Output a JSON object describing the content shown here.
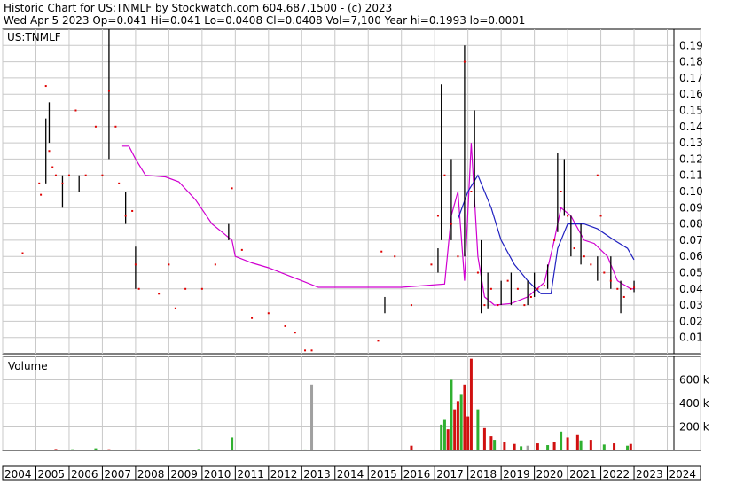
{
  "header": {
    "line1": "Historic Chart for US:TNMLF by Stockwatch.com 604.687.1500 - (c) 2023",
    "line2": "Wed Apr  5 2023  Op=0.041  Hi=0.041  Lo=0.0408  Cl=0.0408  Vol=7,100  Year hi=0.1993  lo=0.0001"
  },
  "price_panel_label": "US:TNMLF",
  "volume_panel_label": "Volume",
  "colors": {
    "grid": "#c8c8c8",
    "price_bar": "#000000",
    "close_dot": "#e00000",
    "ma_short": "#d000d0",
    "ma_long": "#2020c0",
    "vol_up": "#30b030",
    "vol_down": "#d01010",
    "vol_flat": "#a0a0a0"
  },
  "chart_data": [
    {
      "type": "line",
      "title": "US:TNMLF",
      "ylim": [
        0,
        0.2
      ],
      "yticks": [
        "0.01",
        "0.02",
        "0.03",
        "0.04",
        "0.05",
        "0.06",
        "0.07",
        "0.08",
        "0.09",
        "0.10",
        "0.11",
        "0.12",
        "0.13",
        "0.14",
        "0.15",
        "0.16",
        "0.17",
        "0.18",
        "0.19"
      ],
      "x_years": [
        "2004",
        "2005",
        "2006",
        "2007",
        "2008",
        "2009",
        "2010",
        "2011",
        "2012",
        "2013",
        "2014",
        "2015",
        "2016",
        "2017",
        "2018",
        "2019",
        "2020",
        "2021",
        "2022",
        "2023",
        "2024"
      ],
      "bars": [
        [
          2005.3,
          0.105,
          0.145,
          0.12
        ],
        [
          2005.4,
          0.13,
          0.155,
          0.14
        ],
        [
          2005.8,
          0.09,
          0.11,
          0.1
        ],
        [
          2006.3,
          0.1,
          0.11,
          0.105
        ],
        [
          2007.2,
          0.12,
          0.2,
          0.15
        ],
        [
          2007.7,
          0.08,
          0.1,
          0.09
        ],
        [
          2008.0,
          0.04,
          0.066,
          0.05
        ],
        [
          2010.8,
          0.07,
          0.08,
          0.075
        ],
        [
          2015.5,
          0.025,
          0.035,
          0.03
        ],
        [
          2017.1,
          0.05,
          0.065,
          0.055
        ],
        [
          2017.2,
          0.07,
          0.166,
          0.1
        ],
        [
          2017.5,
          0.07,
          0.12,
          0.09
        ],
        [
          2017.9,
          0.06,
          0.19,
          0.12
        ],
        [
          2018.2,
          0.09,
          0.15,
          0.11
        ],
        [
          2018.4,
          0.025,
          0.07,
          0.04
        ],
        [
          2018.6,
          0.028,
          0.05,
          0.035
        ],
        [
          2019.0,
          0.03,
          0.045,
          0.037
        ],
        [
          2019.3,
          0.03,
          0.05,
          0.04
        ],
        [
          2019.8,
          0.03,
          0.045,
          0.035
        ],
        [
          2020.0,
          0.035,
          0.05,
          0.042
        ],
        [
          2020.4,
          0.04,
          0.055,
          0.047
        ],
        [
          2020.7,
          0.075,
          0.124,
          0.1
        ],
        [
          2020.9,
          0.085,
          0.12,
          0.1
        ],
        [
          2021.1,
          0.06,
          0.085,
          0.07
        ],
        [
          2021.4,
          0.055,
          0.08,
          0.065
        ],
        [
          2021.9,
          0.045,
          0.06,
          0.05
        ],
        [
          2022.3,
          0.04,
          0.06,
          0.045
        ],
        [
          2022.6,
          0.025,
          0.045,
          0.035
        ],
        [
          2023.0,
          0.038,
          0.045,
          0.041
        ]
      ],
      "closes": [
        [
          2004.6,
          0.062
        ],
        [
          2005.1,
          0.105
        ],
        [
          2005.15,
          0.098
        ],
        [
          2005.3,
          0.165
        ],
        [
          2005.4,
          0.125
        ],
        [
          2005.5,
          0.115
        ],
        [
          2005.6,
          0.11
        ],
        [
          2005.8,
          0.105
        ],
        [
          2006.0,
          0.11
        ],
        [
          2006.2,
          0.15
        ],
        [
          2006.5,
          0.11
        ],
        [
          2006.8,
          0.14
        ],
        [
          2007.0,
          0.11
        ],
        [
          2007.2,
          0.162
        ],
        [
          2007.4,
          0.14
        ],
        [
          2007.5,
          0.105
        ],
        [
          2007.7,
          0.085
        ],
        [
          2007.9,
          0.088
        ],
        [
          2008.0,
          0.055
        ],
        [
          2008.1,
          0.04
        ],
        [
          2008.7,
          0.037
        ],
        [
          2009.0,
          0.055
        ],
        [
          2009.2,
          0.028
        ],
        [
          2009.5,
          0.04
        ],
        [
          2010.0,
          0.04
        ],
        [
          2010.4,
          0.055
        ],
        [
          2010.9,
          0.102
        ],
        [
          2011.2,
          0.064
        ],
        [
          2011.5,
          0.022
        ],
        [
          2012.0,
          0.025
        ],
        [
          2012.5,
          0.017
        ],
        [
          2012.8,
          0.013
        ],
        [
          2013.1,
          0.002
        ],
        [
          2013.3,
          0.002
        ],
        [
          2015.3,
          0.008
        ],
        [
          2015.4,
          0.063
        ],
        [
          2015.8,
          0.06
        ],
        [
          2016.3,
          0.03
        ],
        [
          2016.9,
          0.055
        ],
        [
          2017.1,
          0.085
        ],
        [
          2017.3,
          0.11
        ],
        [
          2017.5,
          0.08
        ],
        [
          2017.7,
          0.06
        ],
        [
          2017.9,
          0.18
        ],
        [
          2018.1,
          0.1
        ],
        [
          2018.3,
          0.05
        ],
        [
          2018.5,
          0.03
        ],
        [
          2018.7,
          0.04
        ],
        [
          2018.9,
          0.03
        ],
        [
          2019.2,
          0.045
        ],
        [
          2019.5,
          0.04
        ],
        [
          2019.7,
          0.03
        ],
        [
          2019.9,
          0.035
        ],
        [
          2020.1,
          0.04
        ],
        [
          2020.3,
          0.042
        ],
        [
          2020.6,
          0.07
        ],
        [
          2020.8,
          0.1
        ],
        [
          2021.0,
          0.085
        ],
        [
          2021.2,
          0.065
        ],
        [
          2021.5,
          0.06
        ],
        [
          2021.7,
          0.055
        ],
        [
          2021.9,
          0.11
        ],
        [
          2022.0,
          0.085
        ],
        [
          2022.1,
          0.05
        ],
        [
          2022.3,
          0.045
        ],
        [
          2022.5,
          0.04
        ],
        [
          2022.7,
          0.035
        ],
        [
          2022.9,
          0.04
        ],
        [
          2023.0,
          0.0408
        ]
      ],
      "series": [
        {
          "key": "ma_short",
          "points": [
            [
              2007.6,
              0.128
            ],
            [
              2007.8,
              0.128
            ],
            [
              2008.0,
              0.12
            ],
            [
              2008.3,
              0.11
            ],
            [
              2008.9,
              0.109
            ],
            [
              2009.3,
              0.106
            ],
            [
              2009.8,
              0.095
            ],
            [
              2010.3,
              0.08
            ],
            [
              2010.9,
              0.07
            ],
            [
              2011.0,
              0.06
            ],
            [
              2011.5,
              0.056
            ],
            [
              2012.0,
              0.053
            ],
            [
              2012.5,
              0.049
            ],
            [
              2013.0,
              0.045
            ],
            [
              2013.5,
              0.041
            ],
            [
              2014.5,
              0.041
            ],
            [
              2016.0,
              0.041
            ],
            [
              2017.3,
              0.043
            ],
            [
              2017.5,
              0.085
            ],
            [
              2017.7,
              0.1
            ],
            [
              2017.9,
              0.045
            ],
            [
              2018.1,
              0.13
            ],
            [
              2018.3,
              0.06
            ],
            [
              2018.5,
              0.035
            ],
            [
              2018.8,
              0.03
            ],
            [
              2019.3,
              0.031
            ],
            [
              2019.8,
              0.035
            ],
            [
              2020.3,
              0.044
            ],
            [
              2020.6,
              0.07
            ],
            [
              2020.8,
              0.09
            ],
            [
              2021.1,
              0.085
            ],
            [
              2021.5,
              0.07
            ],
            [
              2021.8,
              0.068
            ],
            [
              2022.2,
              0.06
            ],
            [
              2022.5,
              0.045
            ],
            [
              2022.9,
              0.04
            ],
            [
              2023.0,
              0.04
            ]
          ]
        },
        {
          "key": "ma_long",
          "points": [
            [
              2017.7,
              0.083
            ],
            [
              2018.0,
              0.1
            ],
            [
              2018.3,
              0.11
            ],
            [
              2018.7,
              0.09
            ],
            [
              2019.0,
              0.07
            ],
            [
              2019.4,
              0.055
            ],
            [
              2019.8,
              0.045
            ],
            [
              2020.2,
              0.037
            ],
            [
              2020.5,
              0.037
            ],
            [
              2020.7,
              0.065
            ],
            [
              2021.0,
              0.08
            ],
            [
              2021.5,
              0.08
            ],
            [
              2021.9,
              0.077
            ],
            [
              2022.4,
              0.07
            ],
            [
              2022.8,
              0.065
            ],
            [
              2023.0,
              0.058
            ]
          ]
        }
      ]
    },
    {
      "type": "bar",
      "title": "Volume",
      "ylim": [
        0,
        800000
      ],
      "yticks": [
        "200 k",
        "400 k",
        "600 k"
      ],
      "vol_up": [
        [
          2006.1,
          10000
        ],
        [
          2006.8,
          18000
        ],
        [
          2009.9,
          12000
        ],
        [
          2010.9,
          110000
        ],
        [
          2013.1,
          8000
        ],
        [
          2017.2,
          220000
        ],
        [
          2017.3,
          260000
        ],
        [
          2017.5,
          600000
        ],
        [
          2017.8,
          480000
        ],
        [
          2018.3,
          350000
        ],
        [
          2018.8,
          90000
        ],
        [
          2019.6,
          35000
        ],
        [
          2020.4,
          45000
        ],
        [
          2020.8,
          160000
        ],
        [
          2021.4,
          85000
        ],
        [
          2022.1,
          50000
        ],
        [
          2022.8,
          40000
        ]
      ],
      "vol_down": [
        [
          2005.6,
          12000
        ],
        [
          2007.2,
          10000
        ],
        [
          2008.1,
          8000
        ],
        [
          2016.3,
          40000
        ],
        [
          2017.4,
          180000
        ],
        [
          2017.6,
          350000
        ],
        [
          2017.7,
          420000
        ],
        [
          2017.9,
          560000
        ],
        [
          2018.0,
          290000
        ],
        [
          2018.1,
          780000
        ],
        [
          2018.5,
          190000
        ],
        [
          2018.7,
          120000
        ],
        [
          2019.1,
          70000
        ],
        [
          2019.4,
          55000
        ],
        [
          2020.1,
          60000
        ],
        [
          2020.6,
          70000
        ],
        [
          2021.0,
          110000
        ],
        [
          2021.3,
          130000
        ],
        [
          2021.7,
          90000
        ],
        [
          2022.4,
          60000
        ],
        [
          2022.9,
          55000
        ]
      ],
      "vol_flat": [
        [
          2013.3,
          560000
        ],
        [
          2019.8,
          40000
        ]
      ]
    }
  ]
}
